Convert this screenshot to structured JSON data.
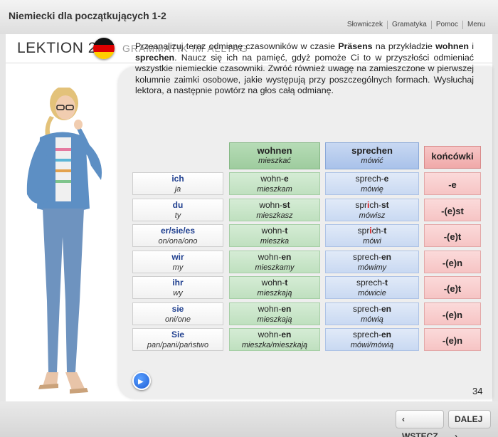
{
  "header": {
    "app_title": "Niemiecki dla początkujących 1-2",
    "nav": [
      "Słowniczek",
      "Gramatyka",
      "Pomoc",
      "Menu"
    ]
  },
  "lesson": {
    "title": "LEKTION 2",
    "section": "GRAMMATIK IM ALLTAG",
    "flag_colors": [
      "#111111",
      "#dd0000",
      "#ffce00"
    ]
  },
  "intro": {
    "p1": "Przeanalizuj teraz odmianę czasowników w czasie ",
    "b1": "Präsens",
    "p2": " na przykładzie ",
    "b2": "wohnen",
    "p3": " i ",
    "b3": "sprechen",
    "p4": ". Naucz się ich na pamięć, gdyż pomoże Ci to w przyszłości odmieniać wszystkie niemieckie czasowniki. Zwróć również uwagę na zamieszczone w pierwszej kolumnie zaimki osobowe, jakie występują przy poszczególnych formach. Wysłuchaj lektora, a następnie powtórz na głos całą odmianę."
  },
  "table": {
    "headers": {
      "wohnen": {
        "de": "wohnen",
        "pl": "mieszkać"
      },
      "sprechen": {
        "de": "sprechen",
        "pl": "mówić"
      },
      "endings": "końcówki"
    },
    "rows": [
      {
        "pron": "ich",
        "pron_pl": "ja",
        "w_stem": "wohn-",
        "w_end": "e",
        "w_pl": "mieszkam",
        "s_a": "sprech-",
        "s_r": "",
        "s_b": "",
        "s_end": "e",
        "s_pl": "mówię",
        "ending": "-e"
      },
      {
        "pron": "du",
        "pron_pl": "ty",
        "w_stem": "wohn-",
        "w_end": "st",
        "w_pl": "mieszkasz",
        "s_a": "spr",
        "s_r": "i",
        "s_b": "ch-",
        "s_end": "st",
        "s_pl": "mówisz",
        "ending": "-(e)st"
      },
      {
        "pron": "er/sie/es",
        "pron_pl": "on/ona/ono",
        "w_stem": "wohn-",
        "w_end": "t",
        "w_pl": "mieszka",
        "s_a": "spr",
        "s_r": "i",
        "s_b": "ch-",
        "s_end": "t",
        "s_pl": "mówi",
        "ending": "-(e)t"
      },
      {
        "pron": "wir",
        "pron_pl": "my",
        "w_stem": "wohn-",
        "w_end": "en",
        "w_pl": "mieszkamy",
        "s_a": "sprech-",
        "s_r": "",
        "s_b": "",
        "s_end": "en",
        "s_pl": "mówimy",
        "ending": "-(e)n"
      },
      {
        "pron": "ihr",
        "pron_pl": "wy",
        "w_stem": "wohn-",
        "w_end": "t",
        "w_pl": "mieszkają",
        "s_a": "sprech-",
        "s_r": "",
        "s_b": "",
        "s_end": "t",
        "s_pl": "mówicie",
        "ending": "-(e)t"
      },
      {
        "pron": "sie",
        "pron_pl": "oni/one",
        "w_stem": "wohn-",
        "w_end": "en",
        "w_pl": "mieszkają",
        "s_a": "sprech-",
        "s_r": "",
        "s_b": "",
        "s_end": "en",
        "s_pl": "mówią",
        "ending": "-(e)n"
      },
      {
        "pron": "Sie",
        "pron_pl": "pan/pani/państwo",
        "w_stem": "wohn-",
        "w_end": "en",
        "w_pl": "mieszka/mieszkają",
        "s_a": "sprech-",
        "s_r": "",
        "s_b": "",
        "s_end": "en",
        "s_pl": "mówi/mówią",
        "ending": "-(e)n"
      }
    ]
  },
  "page_number": "34",
  "footer": {
    "back": "WSTECZ",
    "next": "DALEJ"
  }
}
